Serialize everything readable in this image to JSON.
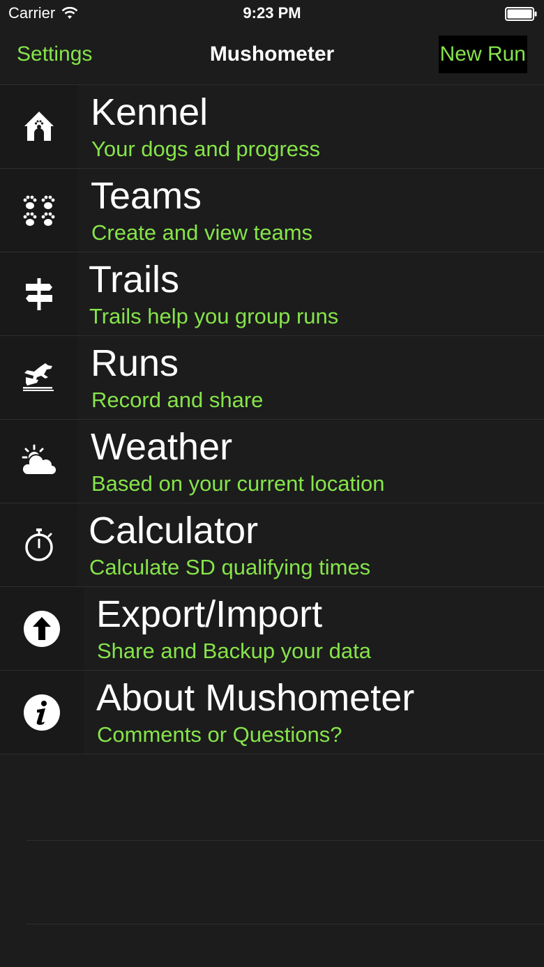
{
  "status_bar": {
    "carrier": "Carrier",
    "time": "9:23 PM",
    "wifi_icon": "wifi-icon",
    "battery_icon": "battery-icon"
  },
  "nav": {
    "left_button": "Settings",
    "title": "Mushometer",
    "right_button": "New Run"
  },
  "colors": {
    "accent": "#86e44a",
    "background": "#1c1c1c",
    "icon_cell": "#191919",
    "separator": "#2e2e2e"
  },
  "menu": {
    "items": [
      {
        "icon": "doghouse-icon",
        "title": "Kennel",
        "subtitle": "Your dogs and progress"
      },
      {
        "icon": "paw-prints-icon",
        "title": "Teams",
        "subtitle": "Create and view teams"
      },
      {
        "icon": "signpost-icon",
        "title": "Trails",
        "subtitle": "Trails help you group runs"
      },
      {
        "icon": "dog-sled-icon",
        "title": "Runs",
        "subtitle": "Record and share"
      },
      {
        "icon": "weather-icon",
        "title": "Weather",
        "subtitle": "Based on your current location"
      },
      {
        "icon": "stopwatch-icon",
        "title": "Calculator",
        "subtitle": "Calculate SD qualifying times"
      },
      {
        "icon": "upload-arrow-icon",
        "title": "Export/Import",
        "subtitle": "Share and Backup your data"
      },
      {
        "icon": "info-icon",
        "title": "About Mushometer",
        "subtitle": "Comments or Questions?"
      }
    ]
  }
}
